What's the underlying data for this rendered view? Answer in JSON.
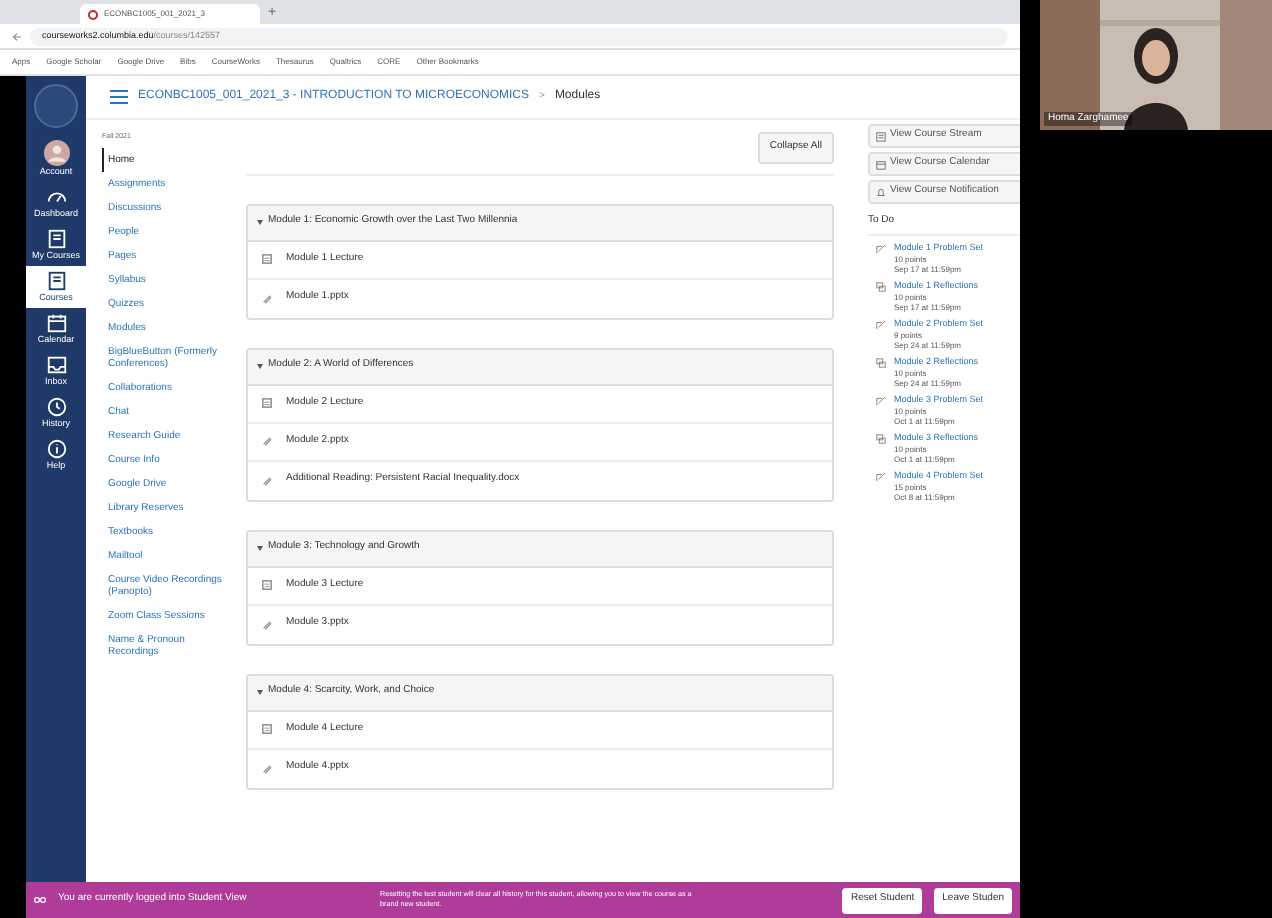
{
  "browser": {
    "tab_title": "ECONBC1005_001_2021_3",
    "new_tab": "+",
    "url_host": "courseworks2.columbia.edu",
    "url_path": "/courses/142557",
    "bookmarks": [
      "Apps",
      "Google Scholar",
      "Google Drive",
      "Bibs",
      "CourseWorks",
      "Thesaurus",
      "Qualtrics",
      "CORE",
      "Other Bookmarks"
    ]
  },
  "global_nav": [
    {
      "label": "Account",
      "selected": false
    },
    {
      "label": "Dashboard",
      "selected": false
    },
    {
      "label": "My Courses",
      "selected": false
    },
    {
      "label": "Courses",
      "selected": true
    },
    {
      "label": "Calendar",
      "selected": false
    },
    {
      "label": "Inbox",
      "selected": false
    },
    {
      "label": "History",
      "selected": false
    },
    {
      "label": "Help",
      "selected": false
    }
  ],
  "breadcrumb": {
    "course": "ECONBC1005_001_2021_3 - INTRODUCTION TO MICROECONOMICS",
    "separator": ">",
    "page": "Modules"
  },
  "course_nav": {
    "term": "Fall 2021",
    "items": [
      {
        "label": "Home",
        "selected": true
      },
      {
        "label": "Assignments",
        "selected": false
      },
      {
        "label": "Discussions",
        "selected": false
      },
      {
        "label": "People",
        "selected": false
      },
      {
        "label": "Pages",
        "selected": false
      },
      {
        "label": "Syllabus",
        "selected": false
      },
      {
        "label": "Quizzes",
        "selected": false
      },
      {
        "label": "Modules",
        "selected": false
      },
      {
        "label": "BigBlueButton (Formerly Conferences)",
        "selected": false
      },
      {
        "label": "Collaborations",
        "selected": false
      },
      {
        "label": "Chat",
        "selected": false
      },
      {
        "label": "Research Guide",
        "selected": false
      },
      {
        "label": "Course Info",
        "selected": false
      },
      {
        "label": "Google Drive",
        "selected": false
      },
      {
        "label": "Library Reserves",
        "selected": false
      },
      {
        "label": "Textbooks",
        "selected": false
      },
      {
        "label": "Mailtool",
        "selected": false
      },
      {
        "label": "Course Video Recordings (Panopto)",
        "selected": false
      },
      {
        "label": "Zoom Class Sessions",
        "selected": false
      },
      {
        "label": "Name & Pronoun Recordings",
        "selected": false
      }
    ]
  },
  "collapse_button": "Collapse All",
  "modules": [
    {
      "title": "Module 1: Economic Growth over the Last Two Millennia",
      "expanded": true,
      "items": [
        {
          "kind": "page",
          "label": "Module 1 Lecture"
        },
        {
          "kind": "file",
          "label": "Module 1.pptx"
        }
      ]
    },
    {
      "title": "Module 2: A World of Differences",
      "expanded": true,
      "items": [
        {
          "kind": "page",
          "label": "Module 2 Lecture"
        },
        {
          "kind": "file",
          "label": "Module 2.pptx"
        },
        {
          "kind": "file",
          "label": "Additional Reading: Persistent Racial Inequality.docx"
        }
      ]
    },
    {
      "title": "Module 3: Technology and Growth",
      "expanded": true,
      "items": [
        {
          "kind": "page",
          "label": "Module 3 Lecture"
        },
        {
          "kind": "file",
          "label": "Module 3.pptx"
        }
      ]
    },
    {
      "title": "Module 4: Scarcity, Work, and Choice",
      "expanded": true,
      "items": [
        {
          "kind": "page",
          "label": "Module 4 Lecture"
        },
        {
          "kind": "file",
          "label": "Module 4.pptx"
        }
      ]
    }
  ],
  "sidebar": {
    "buttons": [
      "View Course Stream",
      "View Course Calendar",
      "View Course Notification"
    ],
    "todo_title": "To Do",
    "todo": [
      {
        "kind": "assignment",
        "title": "Module 1 Problem Set",
        "points": "10 points",
        "due": "Sep 17 at 11:59pm"
      },
      {
        "kind": "discussion",
        "title": "Module 1 Reflections",
        "points": "10 points",
        "due": "Sep 17 at 11:59pm"
      },
      {
        "kind": "assignment",
        "title": "Module 2 Problem Set",
        "points": "9 points",
        "due": "Sep 24 at 11:59pm"
      },
      {
        "kind": "discussion",
        "title": "Module 2 Reflections",
        "points": "10 points",
        "due": "Sep 24 at 11:59pm"
      },
      {
        "kind": "assignment",
        "title": "Module 3 Problem Set",
        "points": "10 points",
        "due": "Oct 1 at 11:59pm"
      },
      {
        "kind": "discussion",
        "title": "Module 3 Reflections",
        "points": "10 points",
        "due": "Oct 1 at 11:59pm"
      },
      {
        "kind": "assignment",
        "title": "Module 4 Problem Set",
        "points": "15 points",
        "due": "Oct 8 at 11:59pm"
      }
    ]
  },
  "student_view": {
    "message": "You are currently logged into Student View",
    "note": "Resetting the test student will clear all history for this student, allowing you to view the course as a brand new student.",
    "buttons": [
      "Reset Student",
      "Leave Studen"
    ]
  },
  "video": {
    "kind": "picture",
    "name": "Homa Zarghamee"
  }
}
